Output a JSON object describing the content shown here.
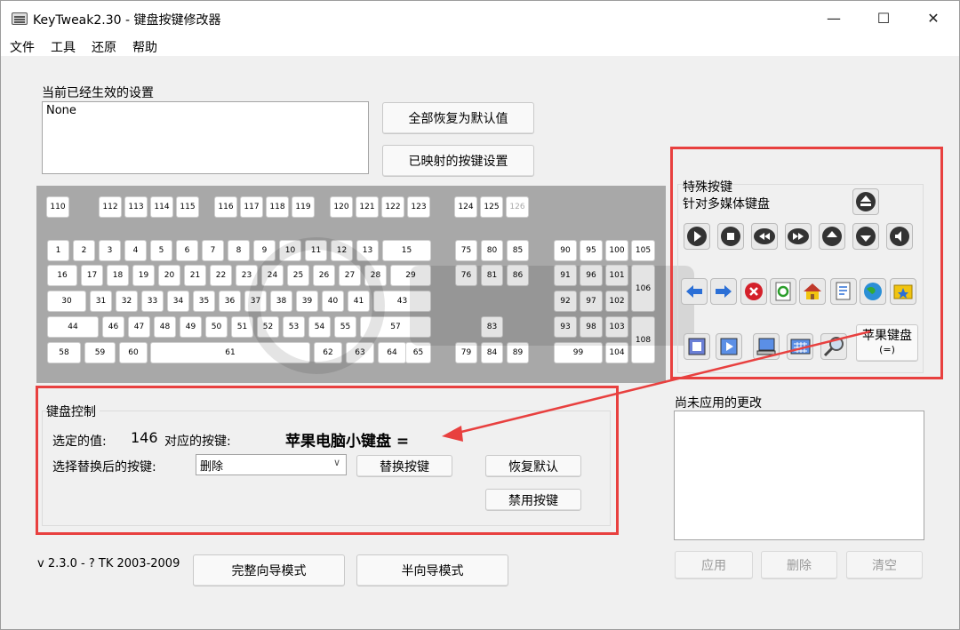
{
  "window": {
    "title": "KeyTweak2.30 -  键盘按键修改器",
    "minimize": "—",
    "maximize": "☐",
    "close": "✕"
  },
  "menu": [
    "文件",
    "工具",
    "还原",
    "帮助"
  ],
  "current_settings": {
    "label": "当前已经生效的设置",
    "value": "None"
  },
  "buttons": {
    "restore_all": "全部恢复为默认值",
    "mapped_keys": "已映射的按键设置",
    "full_wizard": "完整向导模式",
    "half_wizard": "半向导模式"
  },
  "keyboard": {
    "fkeys": [
      "110",
      "112",
      "113",
      "114",
      "115",
      "116",
      "117",
      "118",
      "119",
      "120",
      "121",
      "122",
      "123",
      "124",
      "125",
      "126"
    ],
    "row1": [
      "1",
      "2",
      "3",
      "4",
      "5",
      "6",
      "7",
      "8",
      "9",
      "10",
      "11",
      "12",
      "13",
      "15"
    ],
    "row2": [
      "16",
      "17",
      "18",
      "19",
      "20",
      "21",
      "22",
      "23",
      "24",
      "25",
      "26",
      "27",
      "28",
      "29"
    ],
    "row3": [
      "30",
      "31",
      "32",
      "33",
      "34",
      "35",
      "36",
      "37",
      "38",
      "39",
      "40",
      "41",
      "43"
    ],
    "row4": [
      "44",
      "46",
      "47",
      "48",
      "49",
      "50",
      "51",
      "52",
      "53",
      "54",
      "55",
      "57"
    ],
    "row5": [
      "58",
      "59",
      "60",
      "61",
      "62",
      "63",
      "64",
      "65"
    ],
    "nav": [
      "75",
      "80",
      "85",
      "76",
      "81",
      "86",
      "83",
      "79",
      "84",
      "89"
    ],
    "num": [
      "90",
      "95",
      "100",
      "105",
      "91",
      "96",
      "101",
      "106",
      "92",
      "97",
      "102",
      "93",
      "98",
      "103",
      "108",
      "99",
      "104"
    ]
  },
  "special": {
    "title": "特殊按键",
    "subtitle": "针对多媒体键盘",
    "apple_key": "苹果键盘",
    "apple_key_sub": "(=)",
    "icons": [
      "eject-icon",
      "play-icon",
      "stop-icon",
      "rewind-icon",
      "fast-forward-icon",
      "volume-up-icon",
      "volume-down-icon",
      "mute-icon",
      "back-arrow-icon",
      "forward-arrow-icon",
      "stop-red-icon",
      "refresh-icon",
      "home-icon",
      "search-page-icon",
      "web-globe-icon",
      "favorites-icon",
      "mail-window-icon",
      "media-window-icon",
      "my-computer-icon",
      "calculator-icon",
      "magnifier-icon"
    ]
  },
  "control": {
    "title": "键盘控制",
    "selected_label": "选定的值:",
    "selected_value": "146",
    "corresponds_label": "对应的按键:",
    "corresponds_value": "苹果电脑小键盘 =",
    "replace_label": "选择替换后的按键:",
    "replace_value": "删除",
    "replace_btn": "替换按键",
    "restore_default": "恢复默认",
    "disable_key": "禁用按键"
  },
  "pending": {
    "label": "尚未应用的更改",
    "apply": "应用",
    "delete": "删除",
    "clear": "清空"
  },
  "version": "v 2.3.0 - ? TK 2003-2009",
  "colors": {
    "highlight": "#e8403f",
    "keyboard_bg": "#a8a8a8"
  }
}
